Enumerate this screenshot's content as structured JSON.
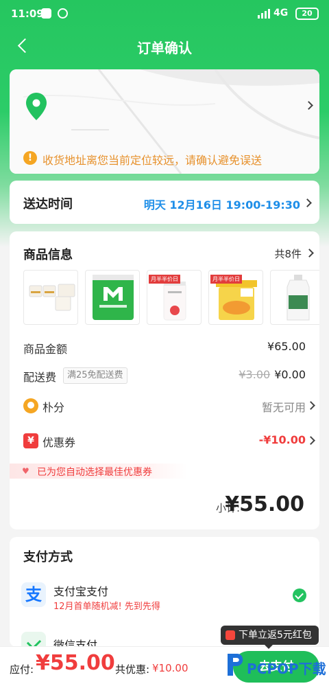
{
  "status_bar": {
    "time": "11:09",
    "network": "4G",
    "battery": "20"
  },
  "nav": {
    "title": "订单确认"
  },
  "address": {
    "warning": "收货地址离您当前定位较远，请确认避免误送"
  },
  "delivery": {
    "label": "送达时间",
    "value": "明天 12月16日 19:00-19:30"
  },
  "goods": {
    "title": "商品信息",
    "count": "共8件",
    "thumb_tags": [
      "月半半价日",
      "月半半价日"
    ],
    "amount_label": "商品金额",
    "amount_value": "¥65.00",
    "shipping_label": "配送费",
    "shipping_badge": "满25免配送费",
    "shipping_original": "¥3.00",
    "shipping_value": "¥0.00",
    "points_label": "朴分",
    "points_value": "暂无可用",
    "coupon_label": "优惠券",
    "coupon_icon": "¥",
    "coupon_value": "-¥10.00",
    "auto_coupon_text": "已为您自动选择最佳优惠券",
    "subtotal_label": "小计:",
    "subtotal_value": "¥55.00"
  },
  "payment": {
    "title": "支付方式",
    "alipay_icon": "支",
    "alipay_name": "支付宝支付",
    "alipay_promo": "12月首单随机减! 先到先得",
    "wechat_name": "微信支付"
  },
  "bottom_bar": {
    "due_label": "应付:",
    "due_value": "¥55.00",
    "discount_label": "共优惠:",
    "discount_value": "¥10.00",
    "pay_button": "去支付",
    "bubble": "下单立返5元红包"
  },
  "watermark": {
    "brand": "PCPOP",
    "suffix": "下载"
  },
  "colors": {
    "brand_green": "#23c360",
    "accent_red": "#f03d3d",
    "link_blue": "#1e8ee8",
    "warning_orange": "#e7912c"
  }
}
